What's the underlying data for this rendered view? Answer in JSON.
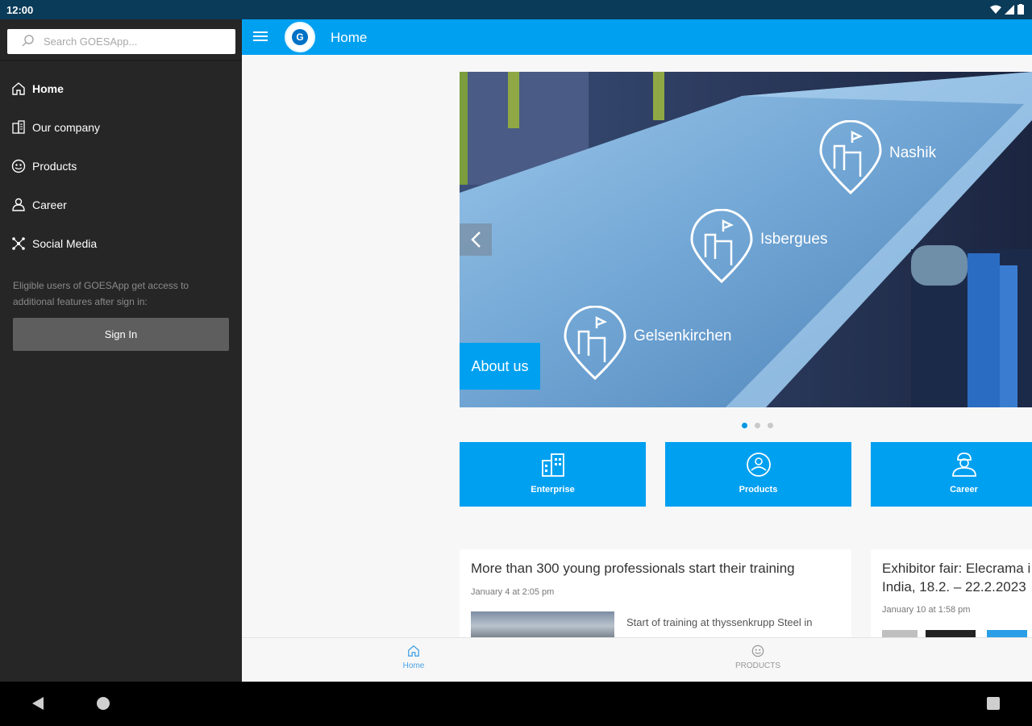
{
  "status_bar": {
    "time": "12:00"
  },
  "app_bar": {
    "title": "Home",
    "logo_letter": "G"
  },
  "drawer": {
    "search_placeholder": "Search GOESApp...",
    "items": [
      {
        "label": "Home",
        "icon": "home-icon",
        "active": true
      },
      {
        "label": "Our company",
        "icon": "building-icon",
        "active": false
      },
      {
        "label": "Products",
        "icon": "products-icon",
        "active": false
      },
      {
        "label": "Career",
        "icon": "career-icon",
        "active": false
      },
      {
        "label": "Social Media",
        "icon": "social-media-icon",
        "active": false
      }
    ],
    "signin_text": "Eligible users of GOESApp get access to additional features after sign in:",
    "signin_button": "Sign In"
  },
  "hero": {
    "about_label": "About us",
    "locations": [
      "Nashik",
      "Isbergues",
      "Gelsenkirchen"
    ],
    "pages": 3,
    "current_page": 1
  },
  "tiles": [
    {
      "label": "Enterprise",
      "icon": "enterprise-icon"
    },
    {
      "label": "Products",
      "icon": "products-icon"
    },
    {
      "label": "Career",
      "icon": "career-icon"
    }
  ],
  "news": [
    {
      "title": "More than 300 young professionals start their training",
      "date": "January 4 at 2:05 pm",
      "excerpt": "Start of training at thyssenkrupp Steel in"
    },
    {
      "title": "Exhibitor fair: Elecrama i",
      "title2": "India, 18.2. – 22.2.2023",
      "date": "January 10 at 1:58 pm"
    }
  ],
  "bottom_nav": [
    {
      "label": "Home",
      "icon": "home-icon",
      "active": true
    },
    {
      "label": "PRODUCTS",
      "icon": "products-icon",
      "active": false
    }
  ],
  "colors": {
    "primary": "#00a0f0",
    "drawer": "#262626",
    "status_bar": "#0a3b59"
  }
}
